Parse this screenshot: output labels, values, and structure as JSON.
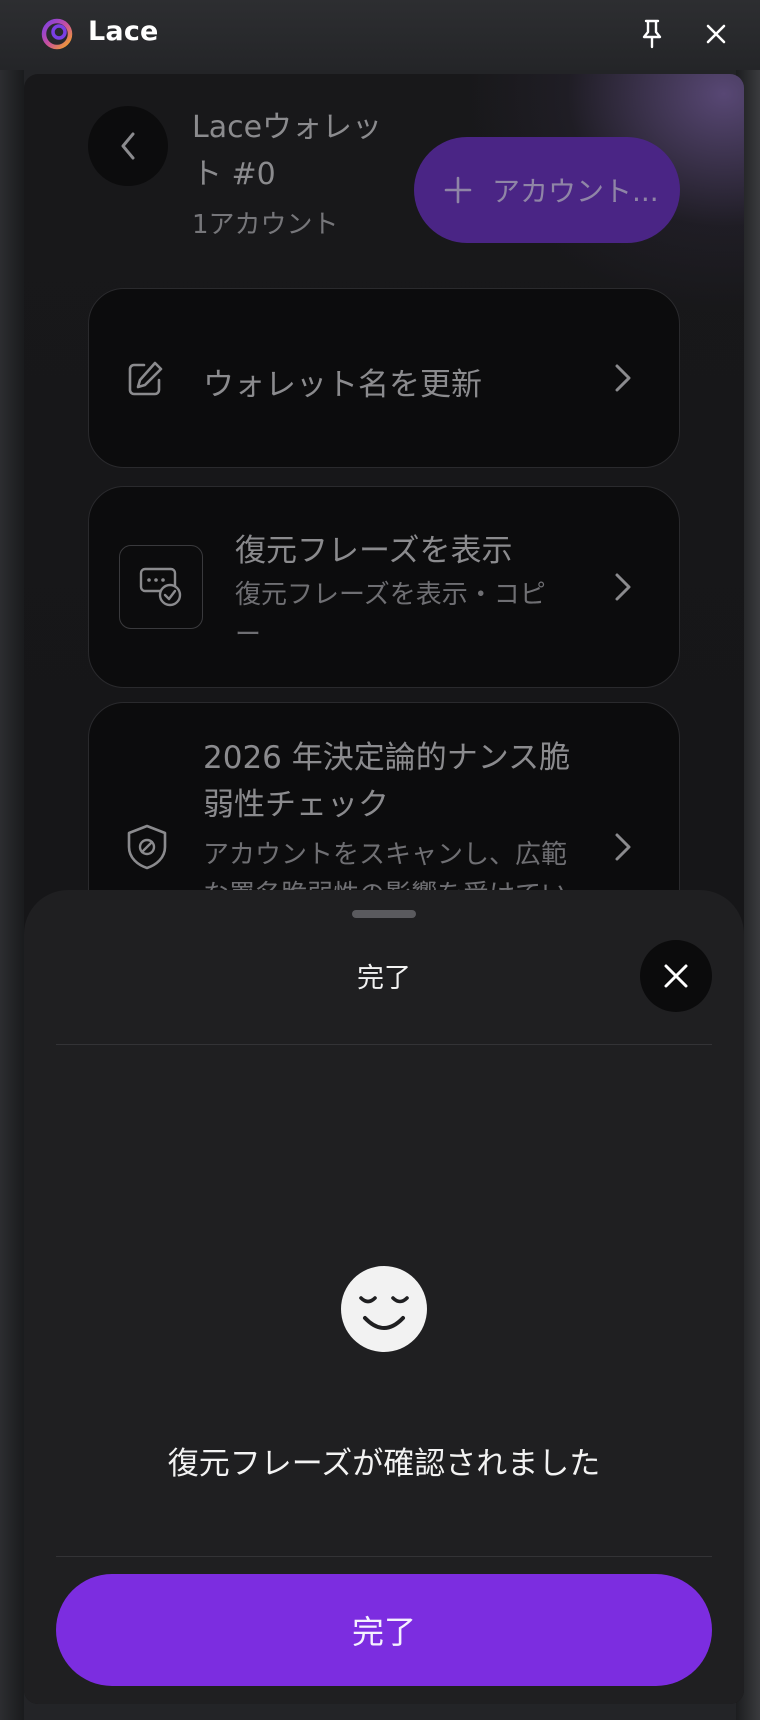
{
  "app": {
    "name": "Lace",
    "logo_icon": "lace-logo-icon",
    "pin_icon": "pin-icon",
    "close_icon": "close-icon"
  },
  "wallet": {
    "name": "Laceウォレット #0",
    "account_count": "1アカウント",
    "add_account_label": "アカウント..."
  },
  "settings": {
    "items": [
      {
        "label": "ウォレット名を更新",
        "icon": "edit-icon"
      },
      {
        "label": "復元フレーズを表示",
        "description": "復元フレーズを表示・コピー",
        "icon": "recovery-phrase-icon"
      },
      {
        "label": "2026 年決定論的ナンス脆弱性チェック",
        "description": "アカウントをスキャンし、広範な署名脆弱性の影響を受けてい",
        "icon": "shield-icon"
      }
    ]
  },
  "sheet": {
    "title": "完了",
    "message": "復元フレーズが確認されました",
    "done_button": "完了",
    "status_icon": "smiley-icon"
  },
  "colors": {
    "accent": "#7c2de0",
    "accent_dim": "#4a2585",
    "sheet_bg": "#1f1f21"
  }
}
